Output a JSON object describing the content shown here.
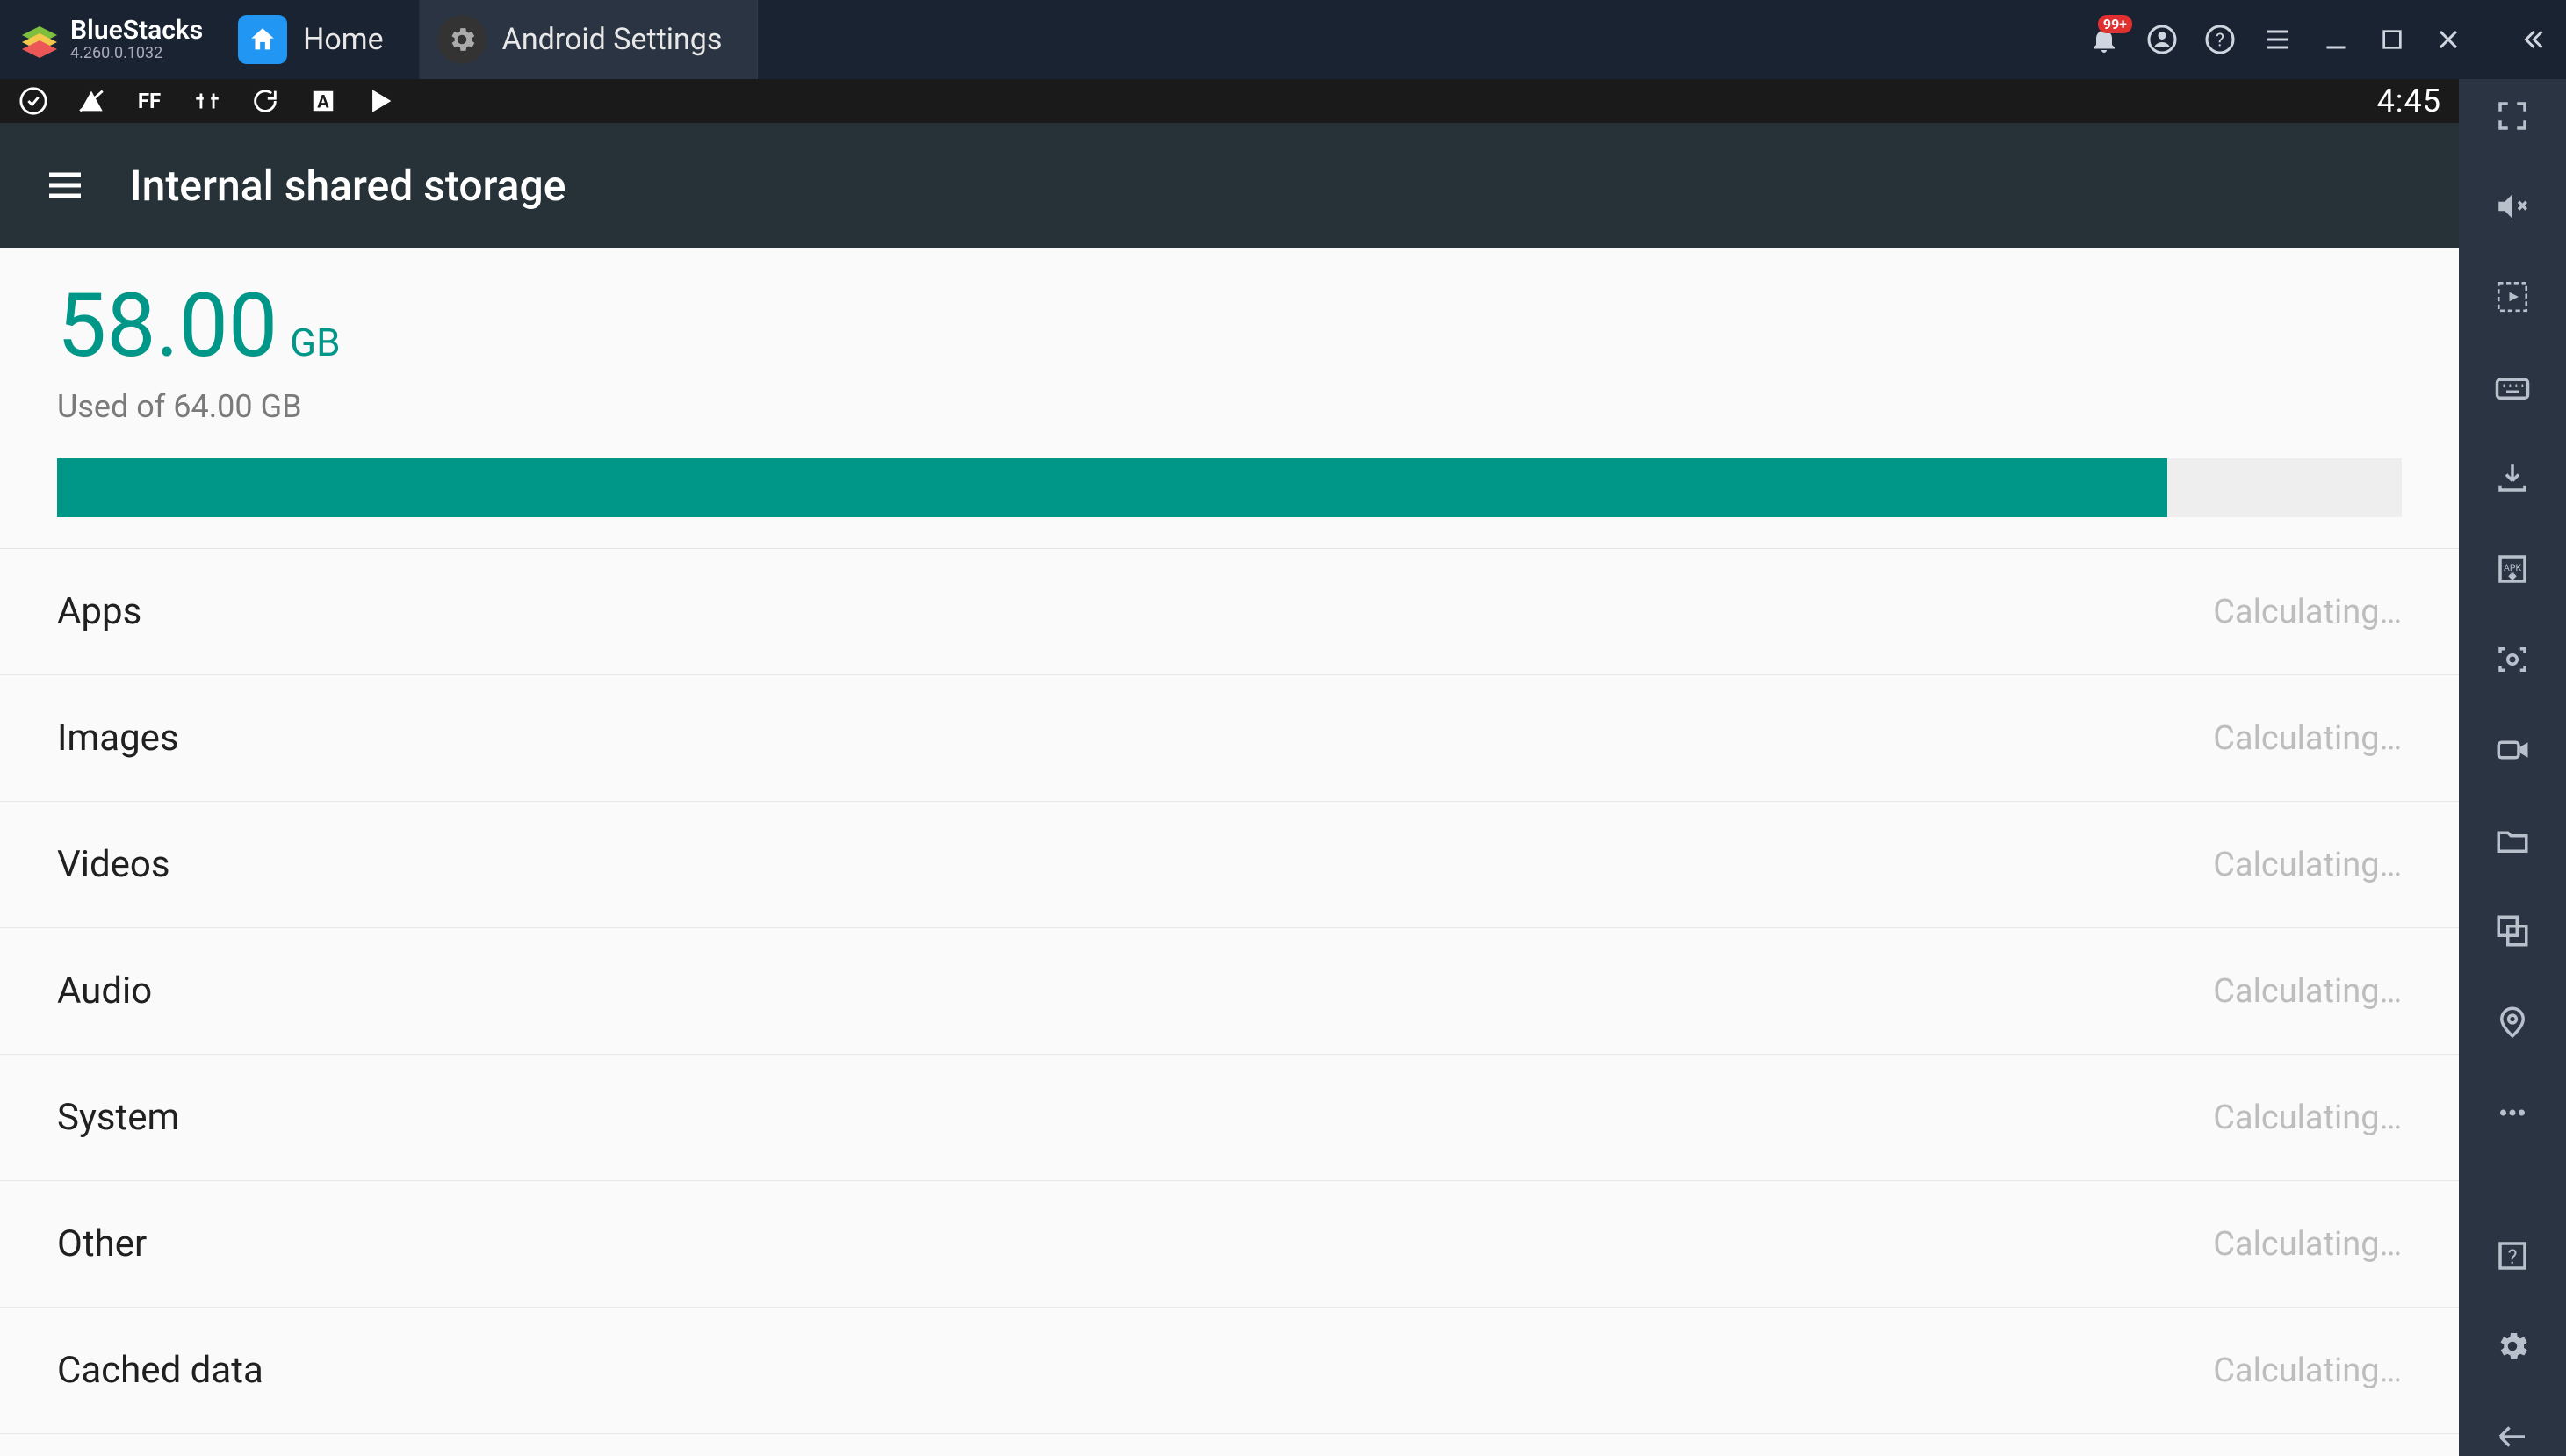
{
  "app": {
    "name": "BlueStacks",
    "version": "4.260.0.1032"
  },
  "tabs": [
    {
      "label": "Home",
      "active": false
    },
    {
      "label": "Android Settings",
      "active": true
    }
  ],
  "titlebar": {
    "notif_badge": "99+"
  },
  "android": {
    "status_time": "4:45",
    "title": "Internal shared storage",
    "storage": {
      "used_value": "58.00",
      "used_unit": "GB",
      "total_label": "Used of 64.00 GB",
      "used_percent": 90
    },
    "categories": [
      {
        "name": "Apps",
        "value": "Calculating…"
      },
      {
        "name": "Images",
        "value": "Calculating…"
      },
      {
        "name": "Videos",
        "value": "Calculating…"
      },
      {
        "name": "Audio",
        "value": "Calculating…"
      },
      {
        "name": "System",
        "value": "Calculating…"
      },
      {
        "name": "Other",
        "value": "Calculating…"
      },
      {
        "name": "Cached data",
        "value": "Calculating…"
      }
    ]
  }
}
